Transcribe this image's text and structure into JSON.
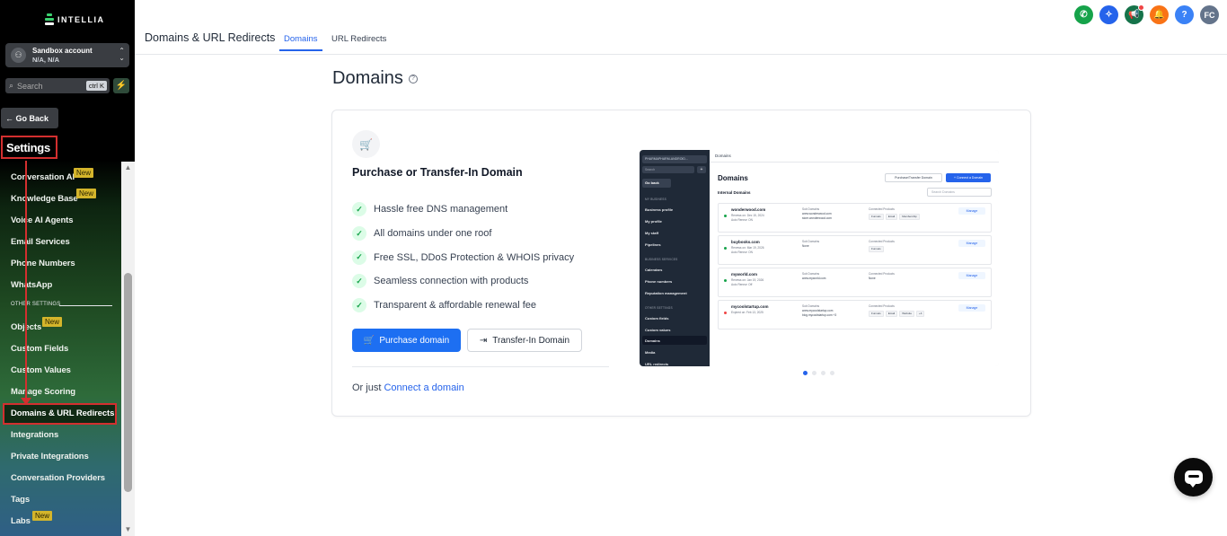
{
  "app": {
    "logo_text": "INTELLIA"
  },
  "account": {
    "name": "Sandbox account",
    "location": "N/A, N/A"
  },
  "search": {
    "placeholder": "Search",
    "shortcut": "ctrl K"
  },
  "sidebar": {
    "go_back": "← Go Back",
    "settings_title": "Settings",
    "other_settings_label": "OTHER SETTINGS",
    "badge_new": "New",
    "items": [
      {
        "label": "Conversation AI",
        "badge": "New"
      },
      {
        "label": "Knowledge Base",
        "badge": "New"
      },
      {
        "label": "Voice AI Agents"
      },
      {
        "label": "Email Services"
      },
      {
        "label": "Phone Numbers"
      },
      {
        "label": "WhatsApp"
      },
      {
        "label": "Objects",
        "badge": "New"
      },
      {
        "label": "Custom Fields"
      },
      {
        "label": "Custom Values"
      },
      {
        "label": "Manage Scoring"
      },
      {
        "label": "Domains & URL Redirects",
        "active": true
      },
      {
        "label": "Integrations"
      },
      {
        "label": "Private Integrations"
      },
      {
        "label": "Conversation Providers"
      },
      {
        "label": "Tags"
      },
      {
        "label": "Labs",
        "badge": "New"
      }
    ]
  },
  "header": {
    "title": "Domains & URL Redirects",
    "tabs": [
      {
        "label": "Domains",
        "active": true
      },
      {
        "label": "URL Redirects"
      }
    ],
    "avatar_initials": "FC",
    "icons": [
      {
        "name": "phone-icon",
        "color": "#16a34a"
      },
      {
        "name": "magic-icon",
        "color": "#2563eb"
      },
      {
        "name": "megaphone-icon",
        "color": "#16734a"
      },
      {
        "name": "bell-icon",
        "color": "#f97316"
      },
      {
        "name": "help-icon",
        "color": "#3b82f6"
      }
    ]
  },
  "main": {
    "heading": "Domains",
    "card": {
      "title": "Purchase or Transfer-In Domain",
      "features": [
        "Hassle free DNS management",
        "All domains under one roof",
        "Free SSL, DDoS Protection & WHOIS privacy",
        "Seamless connection with products",
        "Transparent & affordable renewal fee"
      ],
      "purchase_button": "Purchase domain",
      "transfer_button": "Transfer-In Domain",
      "or_just": "Or just",
      "connect_link": "Connect a domain"
    }
  },
  "preview": {
    "side_account": "PHARMAPHARM-ANDROID...",
    "side_search": "Search",
    "side_go_back": "Go back",
    "side_sections": [
      "MY BUSINESS",
      "BUSINESS SERVICES",
      "OTHER SETTINGS"
    ],
    "side_items": [
      "Business profile",
      "My profile",
      "My staff",
      "Pipelines",
      "Calendars",
      "Phone numbers",
      "Reputation management",
      "Custom fields",
      "Custom values",
      "Domains",
      "Media",
      "URL redirects"
    ],
    "topbar": "Domains",
    "heading": "Domains",
    "btn_transfer": "Purchase/Transfer Domain",
    "btn_connect": "+ Connect a Domain",
    "internal_label": "Internal Domains",
    "search_placeholder": "Search Domains",
    "col_subdomains": "Sub Domains",
    "col_products": "Connected Products",
    "manage": "Manage",
    "rows": [
      {
        "domain": "wonderwood.com",
        "status": "green",
        "sub1": "Renews on: Dec 15, 2024",
        "sub2": "Auto Renew: ON",
        "subdomains": [
          "www.wonderwood.com",
          "store.wonderwood.com"
        ],
        "products": [
          "Funnels",
          "Email",
          "Membership"
        ]
      },
      {
        "domain": "buybooks.com",
        "status": "green",
        "sub1": "Renews on: Mar 19, 2026",
        "sub2": "Auto Renew: ON",
        "subdomains": [
          "None"
        ],
        "products": [
          "Funnels"
        ]
      },
      {
        "domain": "myworld.com",
        "status": "green",
        "sub1": "Renews on: Jan 19, 2026",
        "sub2": "Auto Renew: Off",
        "subdomains": [
          "www.myworld.com"
        ],
        "products": [
          "None"
        ]
      },
      {
        "domain": "mycoolstartup.com",
        "status": "red",
        "sub1": "Expired on: Feb 13, 2025",
        "sub2": "",
        "subdomains": [
          "www.mycoolstartup.com",
          "blog.mycoolstartup.com +3"
        ],
        "products": [
          "Funnels",
          "Email",
          "Website",
          "+4"
        ]
      }
    ]
  }
}
